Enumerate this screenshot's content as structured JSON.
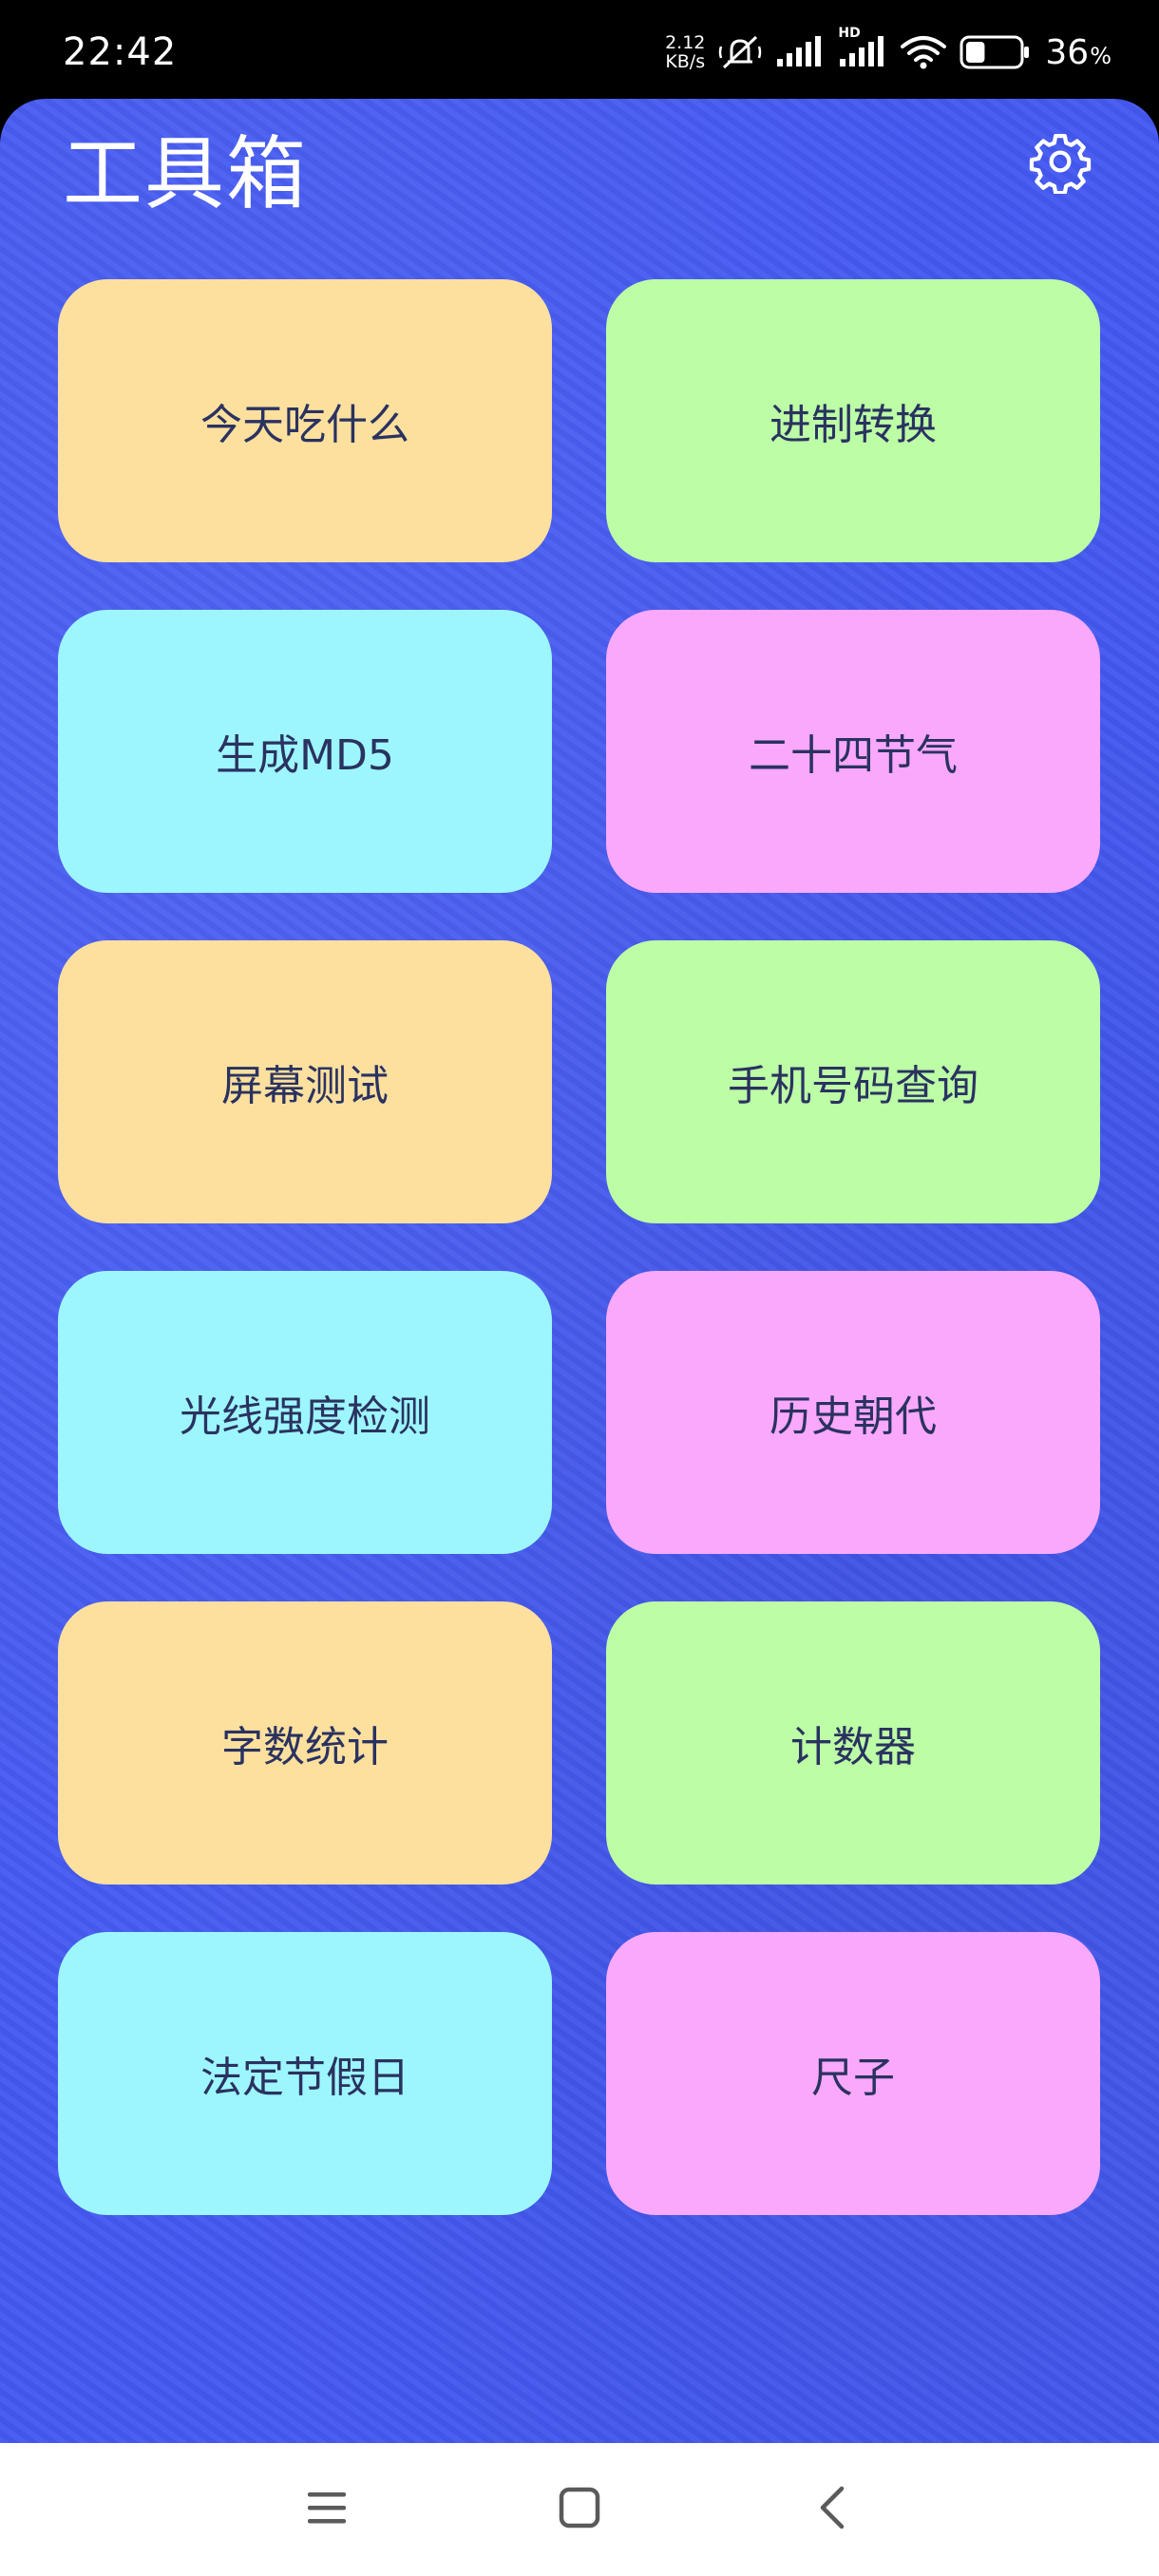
{
  "status_bar": {
    "time": "22:42",
    "net_speed_value": "2.12",
    "net_speed_unit": "KB/s",
    "signal_label": "HD",
    "battery_percent": "36",
    "battery_percent_sign": "%",
    "battery_level": 0.36
  },
  "header": {
    "title": "工具箱",
    "settings_icon": "gear-icon"
  },
  "tools": [
    {
      "label": "今天吃什么",
      "color": "#fde09e"
    },
    {
      "label": "进制转换",
      "color": "#bcfda6"
    },
    {
      "label": "生成MD5",
      "color": "#9df6fe"
    },
    {
      "label": "二十四节气",
      "color": "#f9a8fb"
    },
    {
      "label": "屏幕测试",
      "color": "#fde09e"
    },
    {
      "label": "手机号码查询",
      "color": "#bcfda6"
    },
    {
      "label": "光线强度检测",
      "color": "#9df6fe"
    },
    {
      "label": "历史朝代",
      "color": "#f9a8fb"
    },
    {
      "label": "字数统计",
      "color": "#fde09e"
    },
    {
      "label": "计数器",
      "color": "#bcfda6"
    },
    {
      "label": "法定节假日",
      "color": "#9df6fe"
    },
    {
      "label": "尺子",
      "color": "#f9a8fb"
    }
  ],
  "colors": {
    "background": "#4459f2",
    "card_text": "#2a3260"
  },
  "nav_bar": {
    "icons": [
      "menu-icon",
      "home-icon",
      "back-icon"
    ]
  }
}
